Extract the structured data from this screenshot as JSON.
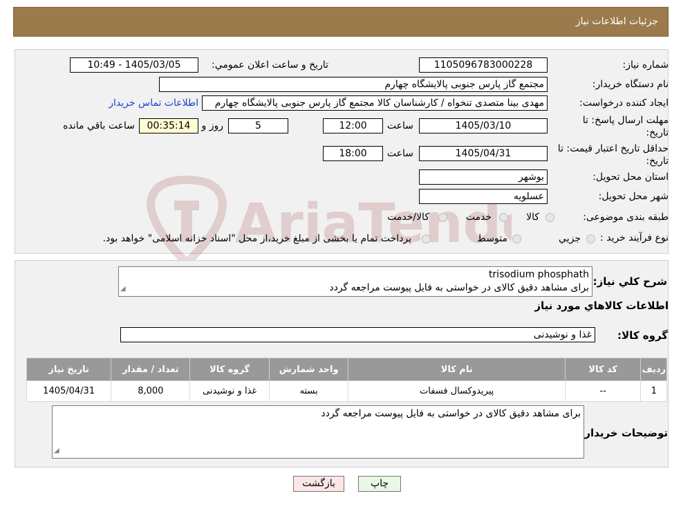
{
  "header": {
    "title": "جزئیات اطلاعات نیاز"
  },
  "fields": {
    "need_number_label": "شماره نیاز:",
    "need_number": "1105096783000228",
    "announce_label": "تاریخ و ساعت اعلان عمومي:",
    "announce_value": "1405/03/05 - 10:49",
    "buyer_org_label": "نام دستگاه خريدار:",
    "buyer_org": "مجتمع گاز پارس جنوبی  پالایشگاه چهارم",
    "creator_label": "ايجاد کننده درخواست:",
    "creator": "مهدی بینا متصدی تنخواه / کارشناسان کالا مجتمع گاز پارس جنوبی  پالایشگاه چهارم",
    "contact_link": "اطلاعات تماس خريدار",
    "deadline_label_1": "مهلت ارسال پاسخ: تا",
    "deadline_label_2": "تاريخ:",
    "deadline_date": "1405/03/10",
    "time_label": "ساعت",
    "deadline_time": "12:00",
    "days_value": "5",
    "days_label": "روز و",
    "remaining_time": "00:35:14",
    "remaining_label": "ساعت باقي مانده",
    "validity_label_1": "حداقل تاريخ اعتبار قيمت: تا",
    "validity_label_2": "تاريخ:",
    "validity_date": "1405/04/31",
    "validity_time": "18:00",
    "province_label": "استان محل تحويل:",
    "province": "بوشهر",
    "city_label": "شهر محل تحويل:",
    "city": "عسلويه",
    "category_label": "طبقه بندی موضوعی:",
    "category_options": [
      "کالا",
      "خدمت",
      "کالا/خدمت"
    ],
    "process_label": "نوع فرآيند خريد :",
    "process_options": [
      "جزيي",
      "متوسط"
    ],
    "process_note": "پرداخت تمام یا بخشی از مبلغ خرید،از محل \"اسناد خزانه اسلامی\" خواهد بود."
  },
  "description": {
    "label": "شرح کلي نياز:",
    "line1": "trisodium phosphath",
    "line2": "برای مشاهد دقیق کالای در خواستی به فایل پیوست مراجعه گردد"
  },
  "goods": {
    "section_title": "اطلاعات کالاهاي مورد نياز",
    "group_label": "گروه کالا:",
    "group_value": "غذا و نوشیدنی",
    "columns": [
      "رديف",
      "کد کالا",
      "نام کالا",
      "واحد شمارش",
      "گروه کالا",
      "تعداد / مقدار",
      "تاريخ نياز"
    ],
    "rows": [
      [
        "1",
        "--",
        "پیریدوکسال فسفات",
        "بسته",
        "غذا و نوشیدنی",
        "8,000",
        "1405/04/31"
      ]
    ]
  },
  "buyer_notes": {
    "label": "توضيحات خريدار:",
    "text": "برای مشاهد دقیق کالای در خواستی به فایل پیوست مراجعه گردد"
  },
  "buttons": {
    "print": "چاپ",
    "back": "بازگشت"
  },
  "watermark": {
    "text": "AriaTender.neT"
  },
  "colors": {
    "header_bg": "#9b7b4b",
    "table_header_bg": "#999999",
    "link": "#1a3fd6",
    "back_button_bg": "#fde6e6",
    "print_button_bg": "#eaf7e4"
  }
}
